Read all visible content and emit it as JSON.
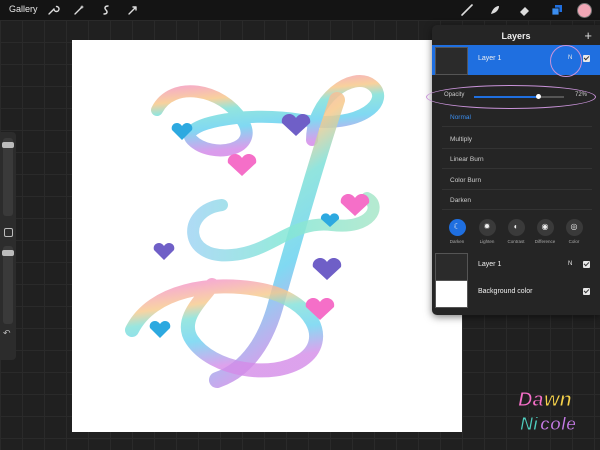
{
  "topbar": {
    "gallery_label": "Gallery",
    "left_tools": [
      "wrench-icon",
      "magic-wand-icon",
      "selection-icon",
      "transform-icon"
    ],
    "right_tools": [
      "brush-icon",
      "smudge-icon",
      "eraser-icon",
      "layers-icon"
    ],
    "color_swatch": "#f1a7b6"
  },
  "layers_panel": {
    "title": "Layers",
    "add_label": "+",
    "active_layer": {
      "name": "Layer 1",
      "blend_tag": "N"
    },
    "opacity": {
      "label": "Opacity",
      "value_text": "72%",
      "value": 0.72
    },
    "blend_modes": [
      "Normal",
      "Multiply",
      "Linear Burn",
      "Color Burn",
      "Darken"
    ],
    "selected_blend": "Normal",
    "mode_groups": [
      {
        "label": "Darken",
        "icon": "moon-icon",
        "active": true
      },
      {
        "label": "Lighten",
        "icon": "sun-icon",
        "active": false
      },
      {
        "label": "Contrast",
        "icon": "contrast-icon",
        "active": false
      },
      {
        "label": "Difference",
        "icon": "difference-icon",
        "active": false
      },
      {
        "label": "Color",
        "icon": "color-icon",
        "active": false
      }
    ],
    "layers": [
      {
        "name": "Layer 1",
        "blend_tag": "N"
      },
      {
        "name": "Background color"
      }
    ]
  },
  "colors": {
    "accent": "#1f6fe0",
    "highlight_ring": "#c993d9"
  }
}
